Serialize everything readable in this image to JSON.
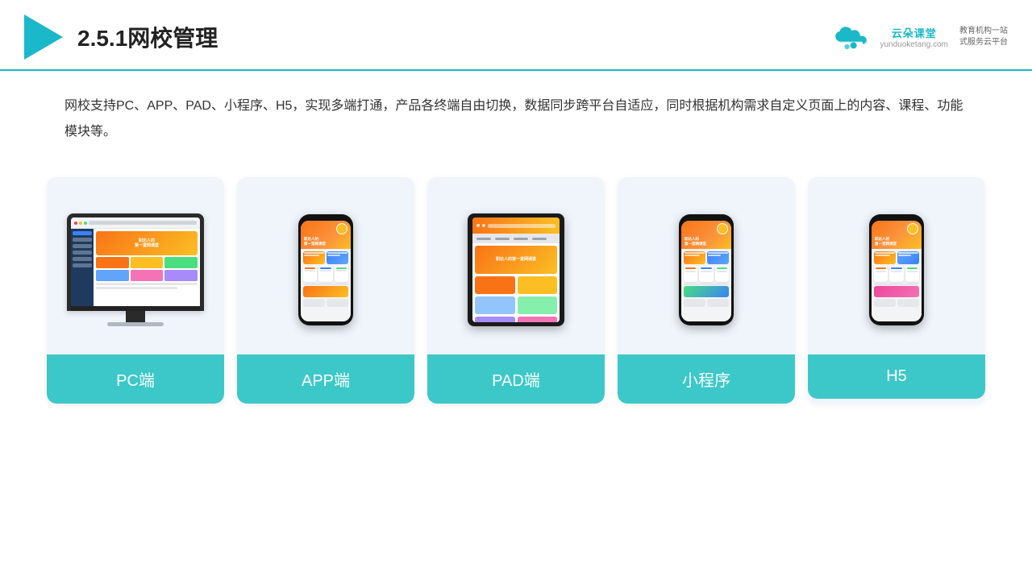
{
  "header": {
    "title": "2.5.1网校管理",
    "brand_name": "云朵课堂",
    "brand_url": "yunduoketang.com",
    "brand_tagline": "教育机构一站\n式服务云平台"
  },
  "description": "网校支持PC、APP、PAD、小程序、H5，实现多端打通，产品各终端自由切换，数据同步跨平台自适应，同时根据机构需求自定义页面上的内容、课程、功能模块等。",
  "cards": [
    {
      "id": "pc",
      "label": "PC端"
    },
    {
      "id": "app",
      "label": "APP端"
    },
    {
      "id": "pad",
      "label": "PAD端"
    },
    {
      "id": "miniapp",
      "label": "小程序"
    },
    {
      "id": "h5",
      "label": "H5"
    }
  ],
  "colors": {
    "accent": "#3cc8c8",
    "header_border": "#1ab8c8",
    "card_bg": "#f0f5fc",
    "label_bg": "#3cc8c8",
    "label_text": "#ffffff"
  }
}
